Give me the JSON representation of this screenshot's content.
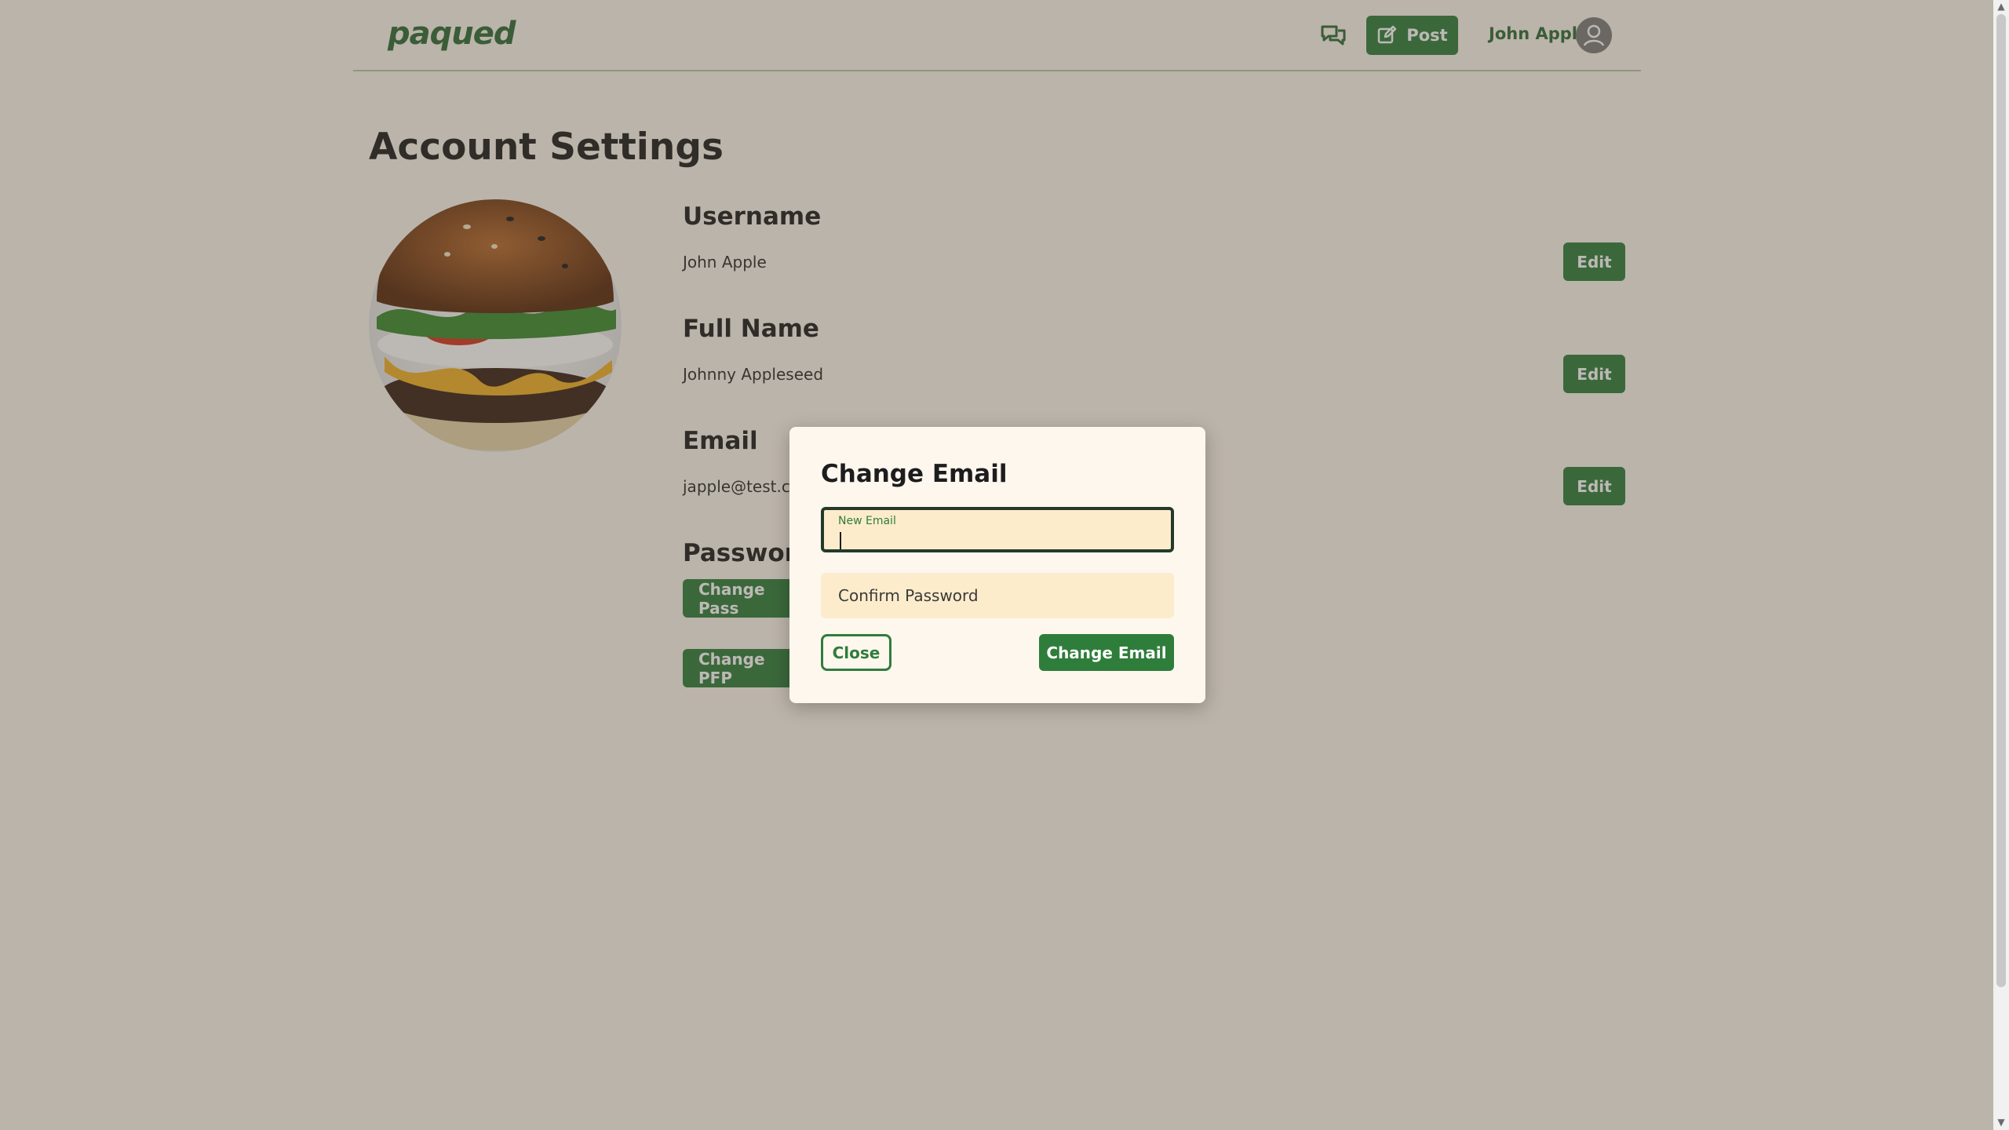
{
  "header": {
    "logo": "paqued",
    "post_label": "Post",
    "user_name": "John Apple"
  },
  "page": {
    "title": "Account Settings"
  },
  "settings": {
    "username_label": "Username",
    "username_value": "John Apple",
    "fullname_label": "Full Name",
    "fullname_value": "Johnny Appleseed",
    "email_label": "Email",
    "email_value": "japple@test.co",
    "password_label": "Password",
    "change_password_label": "Change Pass",
    "change_pfp_label": "Change PFP",
    "edit_label": "Edit"
  },
  "modal": {
    "title": "Change Email",
    "new_email_label": "New Email",
    "new_email_value": "",
    "confirm_password_placeholder": "Confirm Password",
    "close_label": "Close",
    "submit_label": "Change Email"
  },
  "colors": {
    "accent": "#2f7d3b",
    "background": "#fdf7ee",
    "field": "#fdeccb"
  },
  "icons": [
    "chat-icon",
    "edit-square-icon",
    "user-icon",
    "burger-image"
  ]
}
